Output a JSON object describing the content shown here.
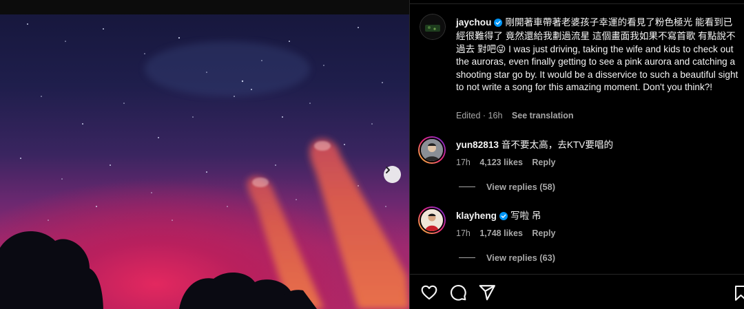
{
  "post": {
    "author": "jaychou",
    "caption": "剛開著車帶著老婆孩子幸運的看見了粉色極光 能看到已經很難得了 竟然還給我劃過流星 這個畫面我如果不寫首歌 有點說不過去 對吧😜 I was just driving, taking the wife and kids to check out the auroras, even finally getting to see a pink aurora and catching a shooting star go by. It would be a disservice to such a beautiful sight to not write a song for this amazing moment. Don't you think?!",
    "edited_time": "Edited · 16h",
    "see_translation": "See translation"
  },
  "comments": [
    {
      "username": "yun82813",
      "verified": false,
      "text": "音不要太高，去KTV要唱的",
      "time": "17h",
      "likes": "4,123 likes",
      "reply": "Reply",
      "view_replies": "View replies (58)"
    },
    {
      "username": "klayheng",
      "verified": true,
      "text": "写啦 吊",
      "time": "17h",
      "likes": "1,748 likes",
      "reply": "Reply",
      "view_replies": "View replies (63)"
    }
  ],
  "icons": {
    "verified": "verified-badge-icon",
    "like": "heart-icon",
    "comment": "comment-icon",
    "share": "send-icon",
    "save": "bookmark-icon",
    "next": "chevron-right-icon"
  },
  "colors": {
    "verified": "#0095f6",
    "muted": "#a8a8a8",
    "text": "#f5f5f5"
  }
}
